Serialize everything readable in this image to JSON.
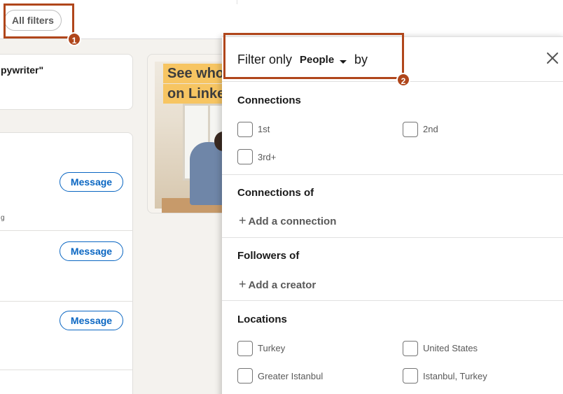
{
  "topbar": {
    "all_filters_label": "All filters"
  },
  "left_results": {
    "card_title": "pywriter\"",
    "message_button_label": "Message",
    "truncated_text": "g"
  },
  "ad": {
    "line1": "See who",
    "line2": "on Linke"
  },
  "filter_panel": {
    "header": {
      "prefix": "Filter only",
      "entity": "People",
      "suffix": "by"
    },
    "sections": {
      "connections": {
        "title": "Connections",
        "options": [
          "1st",
          "2nd",
          "3rd+"
        ]
      },
      "connections_of": {
        "title": "Connections of",
        "add_label": "Add a connection"
      },
      "followers_of": {
        "title": "Followers of",
        "add_label": "Add a creator"
      },
      "locations": {
        "title": "Locations",
        "options": [
          "Turkey",
          "United States",
          "Greater Istanbul",
          "Istanbul, Turkey"
        ]
      }
    }
  },
  "annotations": {
    "badge1": "1",
    "badge2": "2"
  },
  "colors": {
    "accent": "#0a66c2",
    "annotation": "#b0461b"
  }
}
